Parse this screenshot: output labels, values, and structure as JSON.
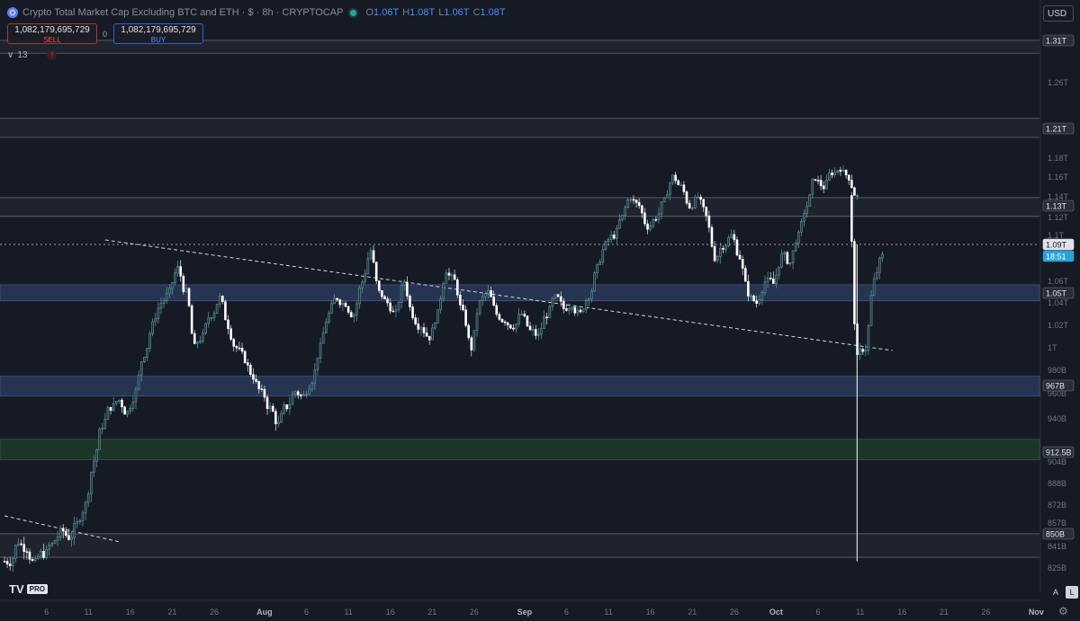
{
  "header": {
    "title": "Crypto Total Market Cap Excluding BTC and ETH",
    "currency_symbol": "$",
    "interval": "8h",
    "exchange": "CRYPTOCAP",
    "ohlc": [
      {
        "key": "O",
        "value": "1.06T"
      },
      {
        "key": "H",
        "value": "1.08T"
      },
      {
        "key": "L",
        "value": "1.06T"
      },
      {
        "key": "C",
        "value": "1.08T"
      }
    ]
  },
  "trade": {
    "sell_price": "1,082,179,695,729",
    "sell_label": "SELL",
    "spread": "0",
    "buy_price": "1,082,179,695,729",
    "buy_label": "BUY"
  },
  "indicator_count": "13",
  "currency_button": "USD",
  "logo": {
    "brand": "TV",
    "badge": "PRO"
  },
  "corner_buttons": {
    "auto": "A",
    "log": "L"
  },
  "colors": {
    "background": "#161a25",
    "blue_zone": "#2a3b5e",
    "green_zone": "#1f3b2a",
    "candle": "#ffffff",
    "wick_up": "#5f9ea5",
    "last_price_tag": "#29a3d6"
  },
  "chart_data": {
    "type": "candlestick",
    "symbol": "Crypto Total Market Cap Excluding BTC and ETH",
    "interval": "8h",
    "x_tick_labels": [
      "6",
      "11",
      "16",
      "21",
      "26",
      "Aug",
      "6",
      "11",
      "16",
      "21",
      "26",
      "Sep",
      "6",
      "11",
      "16",
      "21",
      "26",
      "Oct",
      "6",
      "11",
      "16",
      "21",
      "26",
      "Nov"
    ],
    "y_tick_labels": [
      "1.31T",
      "1.26T",
      "1.21T",
      "1.18T",
      "1.16T",
      "1.14T",
      "1.12T",
      "1.1T",
      "1.06T",
      "1.04T",
      "1.02T",
      "1T",
      "980B",
      "960B",
      "940B",
      "904B",
      "888B",
      "872B",
      "857B",
      "841B",
      "825B"
    ],
    "y_range_billions": [
      815,
      1320
    ],
    "price_tags": [
      {
        "label": "1.31T",
        "value_b": 1310,
        "style": "level"
      },
      {
        "label": "1.21T",
        "value_b": 1210,
        "style": "level"
      },
      {
        "label": "1.13T",
        "value_b": 1130,
        "style": "level"
      },
      {
        "label": "1.09T",
        "value_b": 1090,
        "style": "current"
      },
      {
        "label": "18:51",
        "value_b": 1079,
        "style": "countdown"
      },
      {
        "label": "1.05T",
        "value_b": 1050,
        "style": "level"
      },
      {
        "label": "967B",
        "value_b": 967,
        "style": "level"
      },
      {
        "label": "912.5B",
        "value_b": 912.5,
        "style": "level"
      },
      {
        "label": "850B",
        "value_b": 850,
        "style": "level"
      }
    ],
    "zones": [
      {
        "type": "resistance",
        "color": "blue",
        "from_b": 1042,
        "to_b": 1057
      },
      {
        "type": "support",
        "color": "blue",
        "from_b": 958,
        "to_b": 975
      },
      {
        "type": "support",
        "color": "green",
        "from_b": 906,
        "to_b": 923
      }
    ],
    "horizontal_lines_b": [
      1310,
      1295,
      1221,
      1201,
      1139,
      1121,
      850,
      833
    ],
    "trendlines": [
      {
        "from": {
          "date": "Jul 13",
          "value_b": 1095
        },
        "to": {
          "date": "Oct 14",
          "value_b": 1000
        }
      },
      {
        "from": {
          "date": "Jul 1",
          "value_b": 863
        },
        "to": {
          "date": "Jul 14",
          "value_b": 846
        }
      }
    ],
    "close_path": [
      {
        "date": "Jul 1",
        "close_b": 830
      },
      {
        "date": "Jul 2",
        "close_b": 845
      },
      {
        "date": "Jul 3",
        "close_b": 840
      },
      {
        "date": "Jul 4",
        "close_b": 828
      },
      {
        "date": "Jul 5",
        "close_b": 836
      },
      {
        "date": "Jul 6",
        "close_b": 842
      },
      {
        "date": "Jul 7",
        "close_b": 850
      },
      {
        "date": "Jul 8",
        "close_b": 848
      },
      {
        "date": "Jul 9",
        "close_b": 856
      },
      {
        "date": "Jul 10",
        "close_b": 872
      },
      {
        "date": "Jul 11",
        "close_b": 905
      },
      {
        "date": "Jul 12",
        "close_b": 935
      },
      {
        "date": "Jul 13",
        "close_b": 950
      },
      {
        "date": "Jul 14",
        "close_b": 955
      },
      {
        "date": "Jul 15",
        "close_b": 945
      },
      {
        "date": "Jul 16",
        "close_b": 962
      },
      {
        "date": "Jul 17",
        "close_b": 995
      },
      {
        "date": "Jul 18",
        "close_b": 1020
      },
      {
        "date": "Jul 19",
        "close_b": 1040
      },
      {
        "date": "Jul 20",
        "close_b": 1050
      },
      {
        "date": "Jul 21",
        "close_b": 1070
      },
      {
        "date": "Jul 22",
        "close_b": 1050
      },
      {
        "date": "Jul 23",
        "close_b": 1000
      },
      {
        "date": "Jul 24",
        "close_b": 1010
      },
      {
        "date": "Jul 25",
        "close_b": 1030
      },
      {
        "date": "Jul 26",
        "close_b": 1045
      },
      {
        "date": "Jul 27",
        "close_b": 1020
      },
      {
        "date": "Jul 28",
        "close_b": 1000
      },
      {
        "date": "Jul 29",
        "close_b": 990
      },
      {
        "date": "Jul 30",
        "close_b": 975
      },
      {
        "date": "Jul 31",
        "close_b": 960
      },
      {
        "date": "Aug 1",
        "close_b": 948
      },
      {
        "date": "Aug 2",
        "close_b": 935
      },
      {
        "date": "Aug 3",
        "close_b": 950
      },
      {
        "date": "Aug 4",
        "close_b": 962
      },
      {
        "date": "Aug 5",
        "close_b": 958
      },
      {
        "date": "Aug 6",
        "close_b": 972
      },
      {
        "date": "Aug 7",
        "close_b": 1000
      },
      {
        "date": "Aug 8",
        "close_b": 1030
      },
      {
        "date": "Aug 9",
        "close_b": 1045
      },
      {
        "date": "Aug 10",
        "close_b": 1040
      },
      {
        "date": "Aug 11",
        "close_b": 1030
      },
      {
        "date": "Aug 12",
        "close_b": 1060
      },
      {
        "date": "Aug 13",
        "close_b": 1085
      },
      {
        "date": "Aug 14",
        "close_b": 1050
      },
      {
        "date": "Aug 15",
        "close_b": 1040
      },
      {
        "date": "Aug 16",
        "close_b": 1030
      },
      {
        "date": "Aug 17",
        "close_b": 1060
      },
      {
        "date": "Aug 18",
        "close_b": 1030
      },
      {
        "date": "Aug 19",
        "close_b": 1020
      },
      {
        "date": "Aug 20",
        "close_b": 1010
      },
      {
        "date": "Aug 21",
        "close_b": 1030
      },
      {
        "date": "Aug 22",
        "close_b": 1070
      },
      {
        "date": "Aug 23",
        "close_b": 1060
      },
      {
        "date": "Aug 24",
        "close_b": 1030
      },
      {
        "date": "Aug 25",
        "close_b": 1000
      },
      {
        "date": "Aug 26",
        "close_b": 1040
      },
      {
        "date": "Aug 27",
        "close_b": 1050
      },
      {
        "date": "Aug 28",
        "close_b": 1030
      },
      {
        "date": "Aug 29",
        "close_b": 1025
      },
      {
        "date": "Aug 30",
        "close_b": 1020
      },
      {
        "date": "Aug 31",
        "close_b": 1030
      },
      {
        "date": "Sep 1",
        "close_b": 1015
      },
      {
        "date": "Sep 2",
        "close_b": 1010
      },
      {
        "date": "Sep 3",
        "close_b": 1030
      },
      {
        "date": "Sep 4",
        "close_b": 1045
      },
      {
        "date": "Sep 5",
        "close_b": 1035
      },
      {
        "date": "Sep 6",
        "close_b": 1040
      },
      {
        "date": "Sep 7",
        "close_b": 1030
      },
      {
        "date": "Sep 8",
        "close_b": 1048
      },
      {
        "date": "Sep 9",
        "close_b": 1070
      },
      {
        "date": "Sep 10",
        "close_b": 1090
      },
      {
        "date": "Sep 11",
        "close_b": 1100
      },
      {
        "date": "Sep 12",
        "close_b": 1120
      },
      {
        "date": "Sep 13",
        "close_b": 1140
      },
      {
        "date": "Sep 14",
        "close_b": 1130
      },
      {
        "date": "Sep 15",
        "close_b": 1110
      },
      {
        "date": "Sep 16",
        "close_b": 1120
      },
      {
        "date": "Sep 17",
        "close_b": 1135
      },
      {
        "date": "Sep 18",
        "close_b": 1160
      },
      {
        "date": "Sep 19",
        "close_b": 1150
      },
      {
        "date": "Sep 20",
        "close_b": 1130
      },
      {
        "date": "Sep 21",
        "close_b": 1140
      },
      {
        "date": "Sep 22",
        "close_b": 1120
      },
      {
        "date": "Sep 23",
        "close_b": 1080
      },
      {
        "date": "Sep 24",
        "close_b": 1090
      },
      {
        "date": "Sep 25",
        "close_b": 1100
      },
      {
        "date": "Sep 26",
        "close_b": 1080
      },
      {
        "date": "Sep 27",
        "close_b": 1050
      },
      {
        "date": "Sep 28",
        "close_b": 1040
      },
      {
        "date": "Sep 29",
        "close_b": 1060
      },
      {
        "date": "Sep 30",
        "close_b": 1058
      },
      {
        "date": "Oct 1",
        "close_b": 1080
      },
      {
        "date": "Oct 2",
        "close_b": 1075
      },
      {
        "date": "Oct 3",
        "close_b": 1100
      },
      {
        "date": "Oct 4",
        "close_b": 1130
      },
      {
        "date": "Oct 5",
        "close_b": 1160
      },
      {
        "date": "Oct 6",
        "close_b": 1150
      },
      {
        "date": "Oct 7",
        "close_b": 1165
      },
      {
        "date": "Oct 8",
        "close_b": 1170
      },
      {
        "date": "Oct 9",
        "close_b": 1160
      },
      {
        "date": "Oct 10",
        "close_b": 1140
      },
      {
        "date": "Oct 10",
        "close_b": 990
      },
      {
        "date": "Oct 11",
        "close_b": 1000
      },
      {
        "date": "Oct 12",
        "close_b": 1060
      },
      {
        "date": "Oct 13",
        "close_b": 1080
      }
    ],
    "flash_crash_low_b": 830
  }
}
